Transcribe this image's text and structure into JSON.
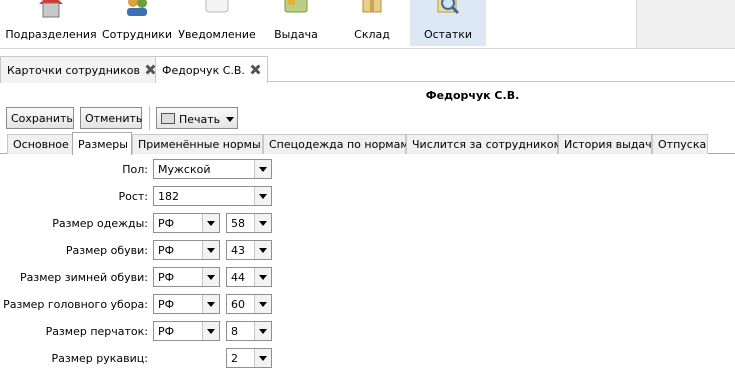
{
  "toolbar": {
    "items": [
      {
        "label": "Подразделения",
        "icon": "house-icon"
      },
      {
        "label": "Сотрудники",
        "icon": "users-icon"
      },
      {
        "label": "Уведомление",
        "icon": "notification-icon"
      },
      {
        "label": "Выдача",
        "icon": "issue-card-icon"
      },
      {
        "label": "Склад",
        "icon": "warehouse-box-icon"
      },
      {
        "label": "Остатки",
        "icon": "magnifier-icon"
      }
    ],
    "active": "Остатки"
  },
  "doc_tabs": [
    {
      "label": "Карточки сотрудников"
    },
    {
      "label": "Федорчук С.В."
    }
  ],
  "title": "Федорчук С.В.",
  "actions": {
    "save": "Сохранить",
    "cancel": "Отменить",
    "print": "Печать"
  },
  "sub_tabs": [
    {
      "label": "Основное"
    },
    {
      "label": "Размеры"
    },
    {
      "label": "Применённые нормы"
    },
    {
      "label": "Спецодежда по нормам"
    },
    {
      "label": "Числится за сотрудником"
    },
    {
      "label": "История выдач"
    },
    {
      "label": "Отпуска"
    }
  ],
  "form": {
    "gender": {
      "label": "Пол:",
      "value": "Мужской"
    },
    "height": {
      "label": "Рост:",
      "value": "182"
    },
    "clothes": {
      "label": "Размер одежды:",
      "standard": "РФ",
      "size": "58"
    },
    "shoes": {
      "label": "Размер обуви:",
      "standard": "РФ",
      "size": "43"
    },
    "winter_shoes": {
      "label": "Размер зимней обуви:",
      "standard": "РФ",
      "size": "44"
    },
    "headwear": {
      "label": "Размер головного убора:",
      "standard": "РФ",
      "size": "60"
    },
    "gloves": {
      "label": "Размер перчаток:",
      "standard": "РФ",
      "size": "8"
    },
    "mittens": {
      "label": "Размер рукавиц:",
      "size": "2"
    }
  },
  "colors": {
    "active_toolbar_bg": "#dde8f5"
  }
}
